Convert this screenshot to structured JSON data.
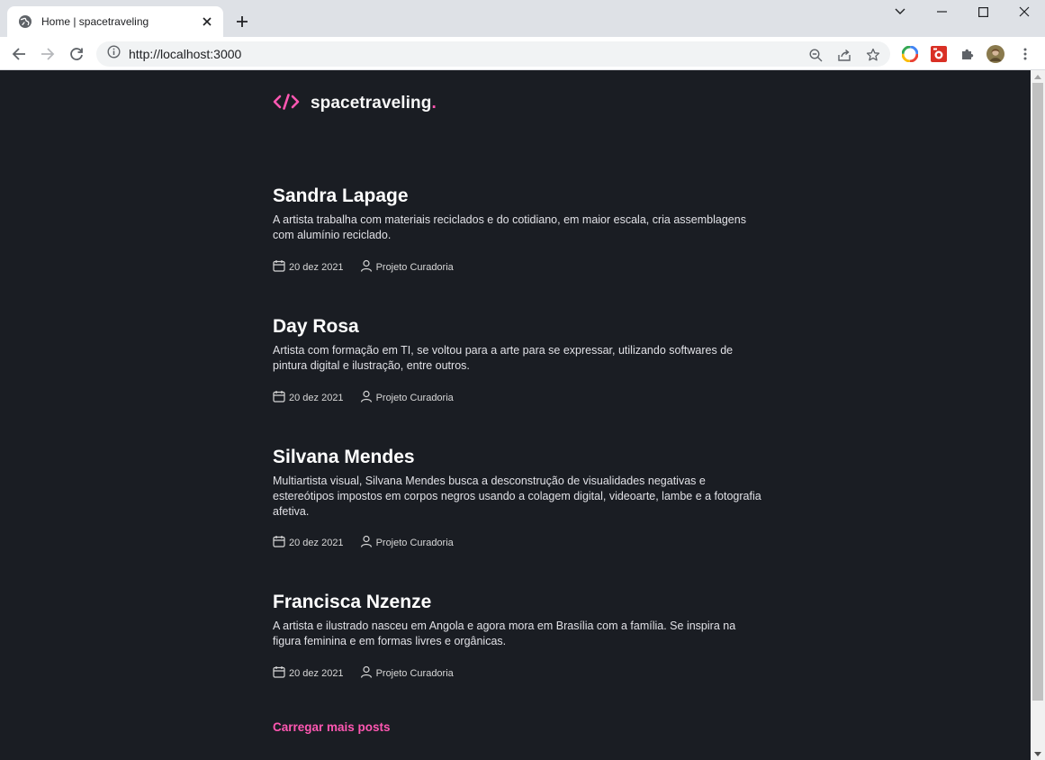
{
  "browser": {
    "tab_title": "Home | spacetraveling",
    "url": "http://localhost:3000"
  },
  "site": {
    "brand": "spacetraveling",
    "brand_dot": "."
  },
  "posts": [
    {
      "title": "Sandra Lapage",
      "excerpt": "A artista trabalha com materiais reciclados e do cotidiano, em maior escala, cria assemblagens com alumínio reciclado.",
      "date": "20 dez 2021",
      "author": "Projeto Curadoria"
    },
    {
      "title": "Day Rosa",
      "excerpt": "Artista com formação em TI, se voltou para a arte para se expressar, utilizando softwares de pintura digital e ilustração, entre outros.",
      "date": "20 dez 2021",
      "author": "Projeto Curadoria"
    },
    {
      "title": "Silvana Mendes",
      "excerpt": "Multiartista visual, Silvana Mendes busca a desconstrução de visualidades negativas e estereótipos impostos em corpos negros usando a colagem digital, videoarte, lambe e a fotografia afetiva.",
      "date": "20 dez 2021",
      "author": "Projeto Curadoria"
    },
    {
      "title": "Francisca Nzenze",
      "excerpt": "A artista e ilustrado nasceu em Angola e agora mora em Brasília com a família. Se inspira na figura feminina e em formas livres e orgânicas.",
      "date": "20 dez 2021",
      "author": "Projeto Curadoria"
    }
  ],
  "load_more_label": "Carregar mais posts",
  "colors": {
    "background": "#1a1d23",
    "accent": "#ff57b2",
    "heading": "#ffffff",
    "body_text": "#e1e1e6"
  }
}
